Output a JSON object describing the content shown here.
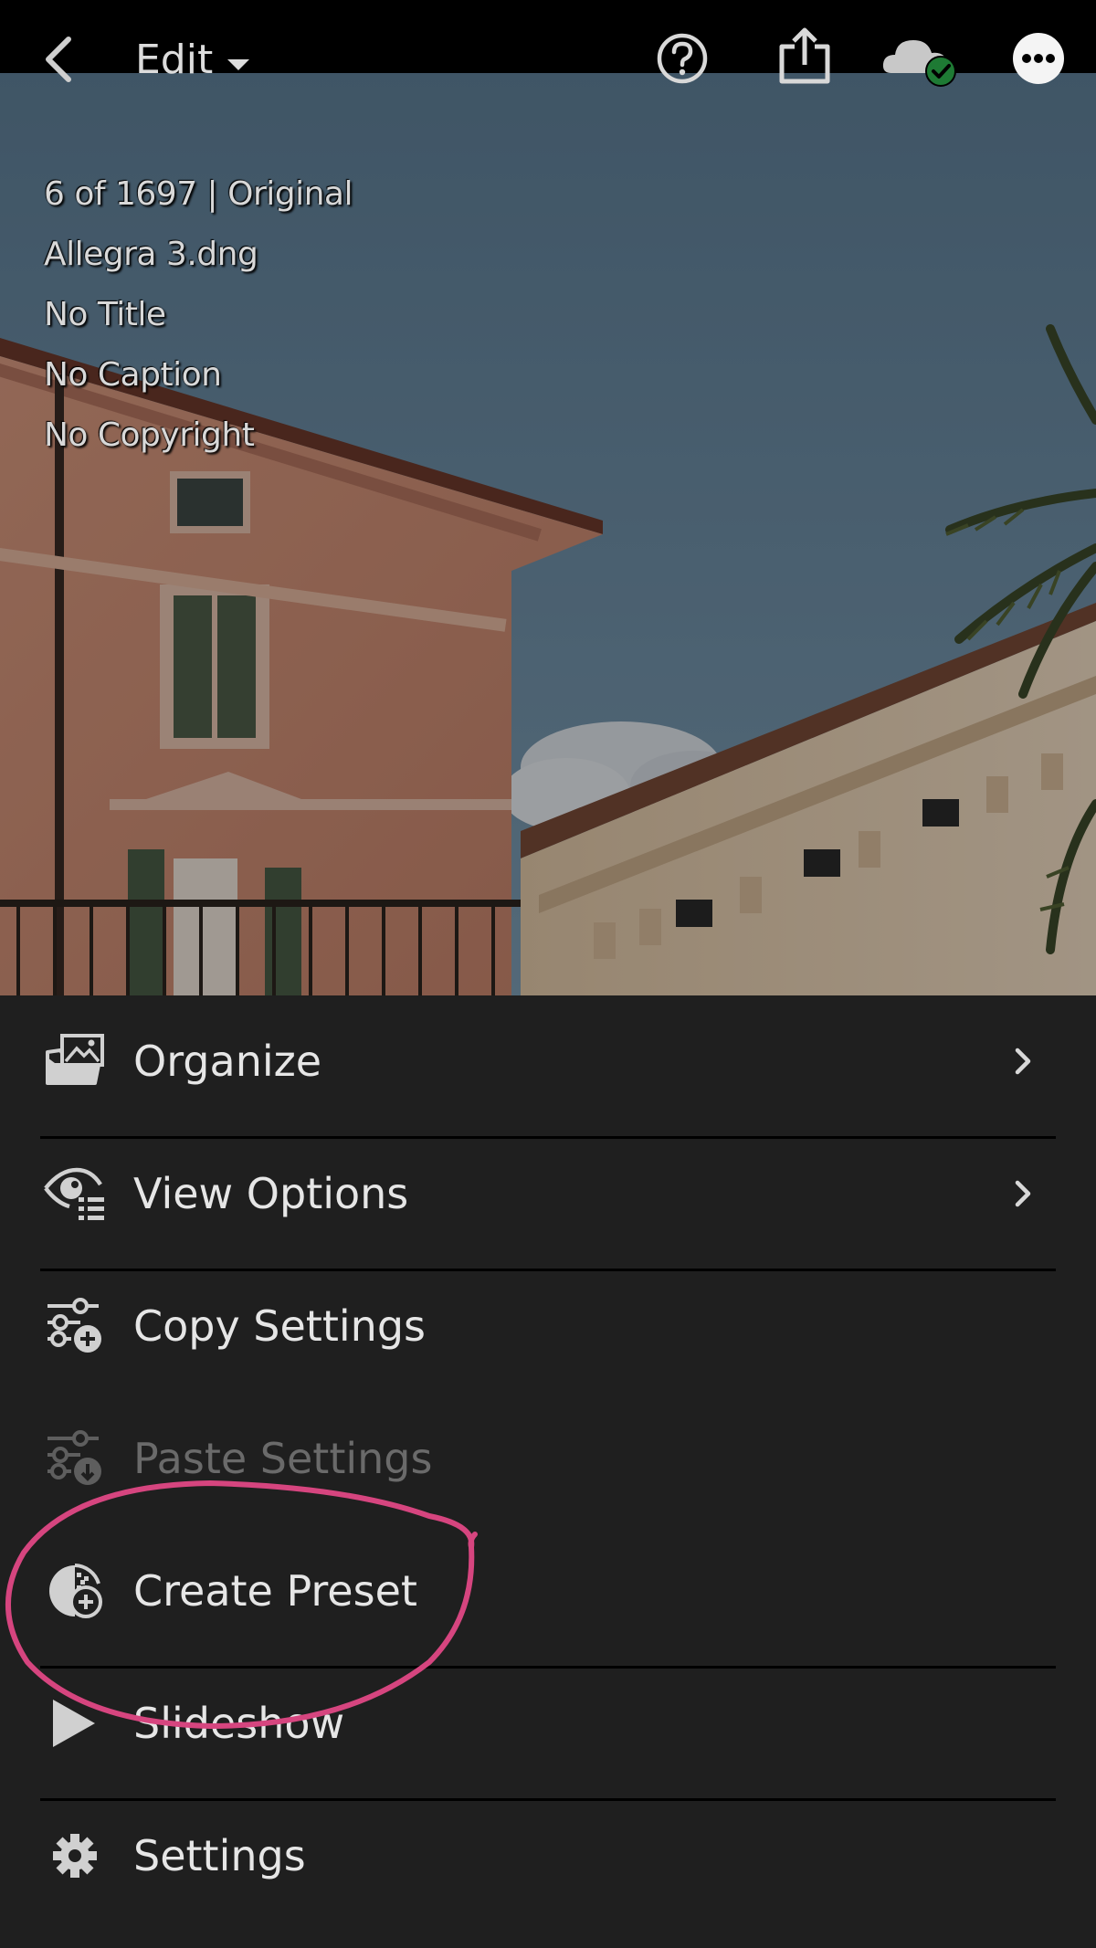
{
  "topbar": {
    "edit_label": "Edit",
    "icons": [
      "back-arrow-icon",
      "help-icon",
      "share-icon",
      "cloud-synced-icon",
      "more-icon"
    ]
  },
  "photo_info": {
    "position": "6 of 1697 | Original",
    "filename": "Allegra 3.dng",
    "title": "No Title",
    "caption": "No Caption",
    "copyright": "No Copyright"
  },
  "menu": {
    "items": [
      {
        "label": "Organize",
        "icon": "organize-icon",
        "has_submenu": true,
        "enabled": true
      },
      {
        "label": "View Options",
        "icon": "view-options-icon",
        "has_submenu": true,
        "enabled": true
      },
      {
        "label": "Copy Settings",
        "icon": "copy-settings-icon",
        "has_submenu": false,
        "enabled": true
      },
      {
        "label": "Paste Settings",
        "icon": "paste-settings-icon",
        "has_submenu": false,
        "enabled": false
      },
      {
        "label": "Create Preset",
        "icon": "create-preset-icon",
        "has_submenu": false,
        "enabled": true
      },
      {
        "label": "Slideshow",
        "icon": "play-icon",
        "has_submenu": false,
        "enabled": true
      },
      {
        "label": "Settings",
        "icon": "gear-icon",
        "has_submenu": false,
        "enabled": true
      }
    ]
  },
  "colors": {
    "menu_background": "#1f1f1f",
    "topbar_background": "#000000",
    "text": "#e6e6e6",
    "disabled_text": "#6a6a6a",
    "annotation": "#d6457f",
    "sync_check": "#2a8a3e"
  }
}
